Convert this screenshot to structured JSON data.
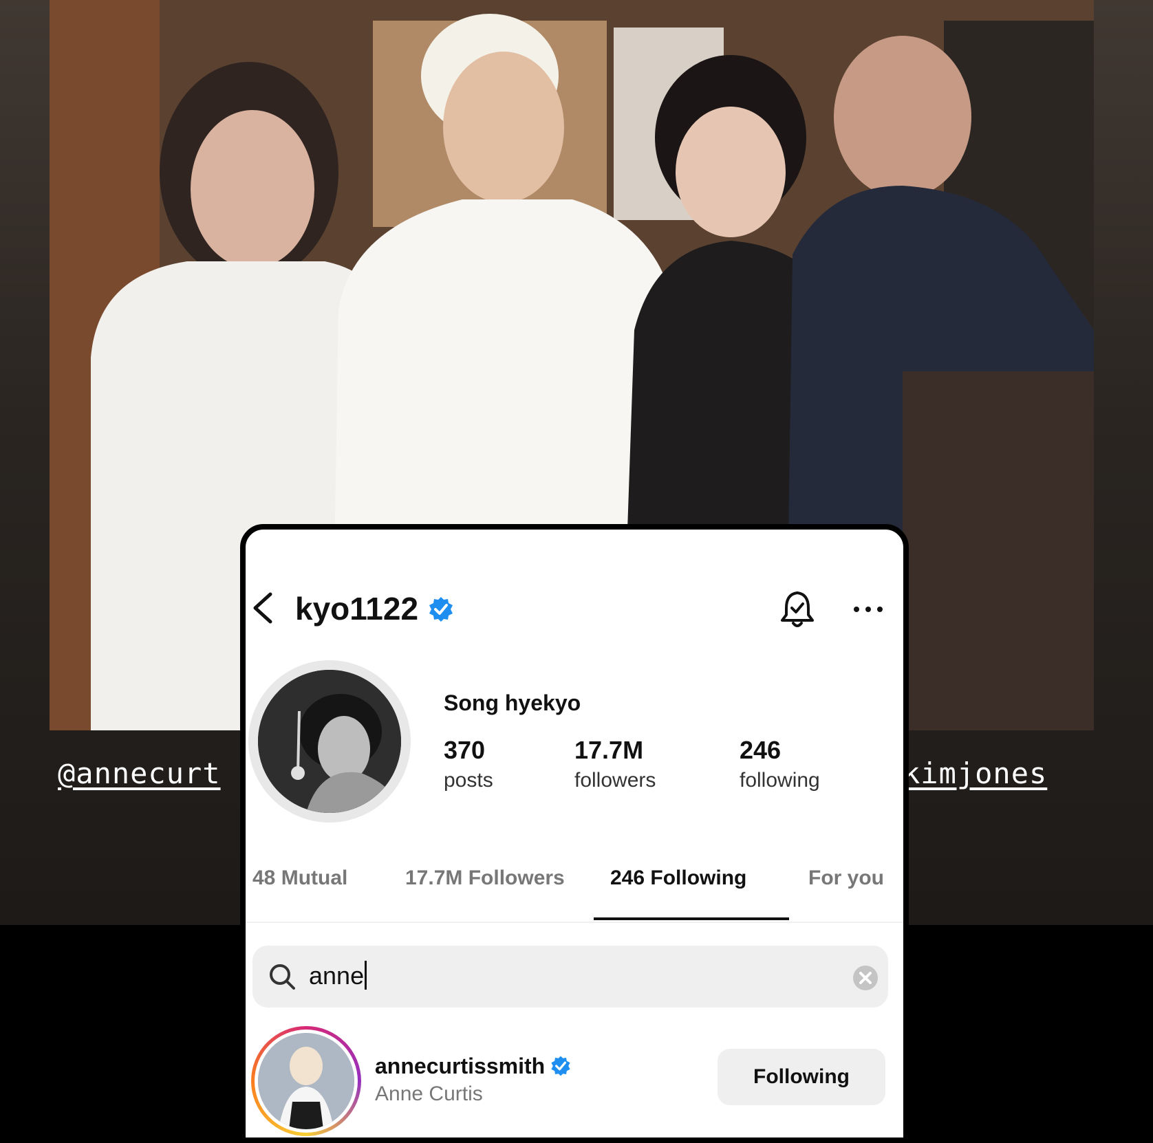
{
  "story": {
    "tag_left": "@annecurt",
    "tag_right": "kimjones"
  },
  "profile": {
    "username": "kyo1122",
    "display_name": "Song hyekyo",
    "stats": {
      "posts_count": "370",
      "posts_label": "posts",
      "followers_count": "17.7M",
      "followers_label": "followers",
      "following_count": "246",
      "following_label": "following"
    }
  },
  "tabs": [
    {
      "label": "48 Mutual",
      "active": false
    },
    {
      "label": "17.7M Followers",
      "active": false
    },
    {
      "label": "246 Following",
      "active": true
    },
    {
      "label": "For you",
      "active": false
    }
  ],
  "search": {
    "value": "anne"
  },
  "results": [
    {
      "username": "annecurtissmith",
      "full_name": "Anne Curtis",
      "verified": true,
      "button_label": "Following"
    }
  ],
  "icons": {
    "back": "chevron-left-icon",
    "verified": "verified-badge-icon",
    "bell": "notification-bell-icon",
    "more": "more-dots-icon",
    "search": "search-icon",
    "clear": "clear-circle-icon"
  },
  "colors": {
    "verified_blue": "#1f8ef1",
    "tab_active": "#111111",
    "tab_inactive": "#777777",
    "story_ring": "#d62976"
  }
}
